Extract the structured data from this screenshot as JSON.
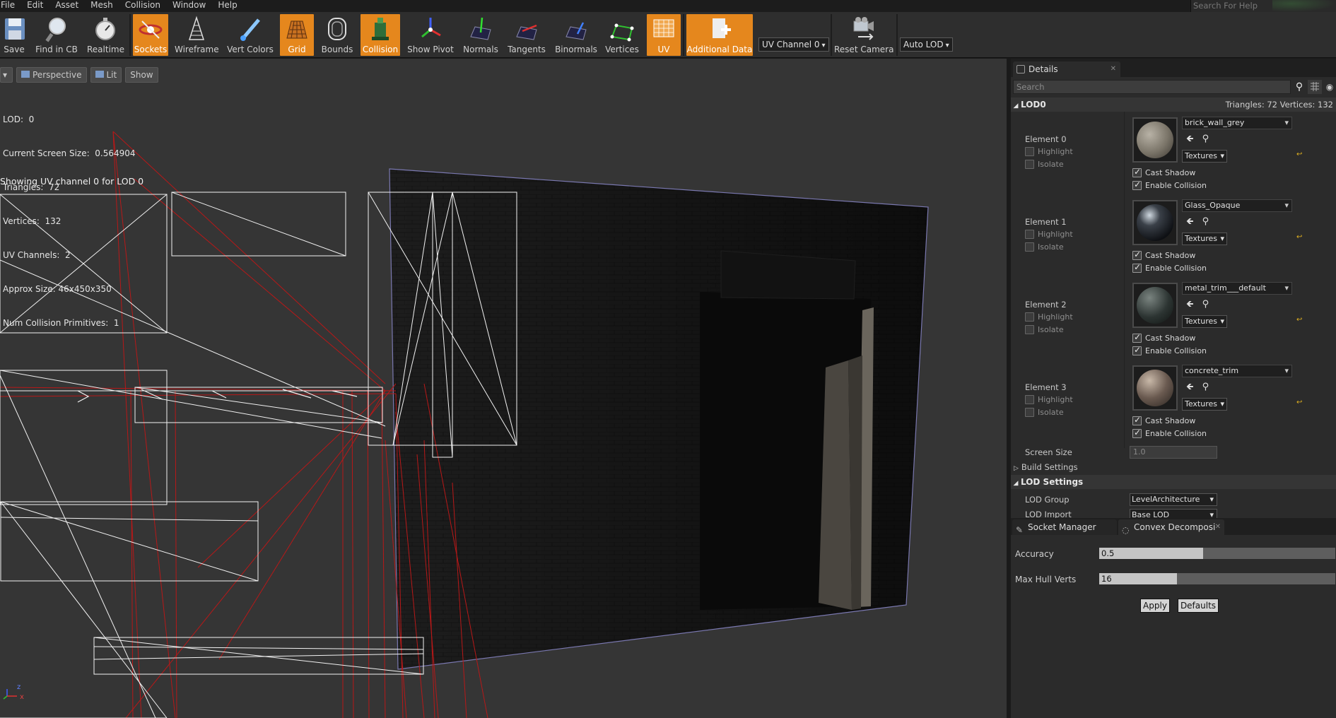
{
  "menu": [
    "File",
    "Edit",
    "Asset",
    "Mesh",
    "Collision",
    "Window",
    "Help"
  ],
  "help_search_placeholder": "Search For Help",
  "toolbar": {
    "buttons": [
      {
        "label": "Save",
        "icon": "floppy-disk-icon",
        "active": false
      },
      {
        "label": "Find in CB",
        "icon": "magnifier-icon",
        "active": false
      },
      {
        "label": "Realtime",
        "icon": "stopwatch-icon",
        "active": false
      },
      {
        "label": "Sockets",
        "icon": "socket-icon",
        "active": true
      },
      {
        "label": "Wireframe",
        "icon": "wireframe-icon",
        "active": false
      },
      {
        "label": "Vert Colors",
        "icon": "paintbrush-icon",
        "active": false
      },
      {
        "label": "Grid",
        "icon": "grid-icon",
        "active": true
      },
      {
        "label": "Bounds",
        "icon": "bounds-icon",
        "active": false
      },
      {
        "label": "Collision",
        "icon": "collision-icon",
        "active": true
      },
      {
        "label": "Show Pivot",
        "icon": "pivot-icon",
        "active": false
      },
      {
        "label": "Normals",
        "icon": "normals-icon",
        "active": false
      },
      {
        "label": "Tangents",
        "icon": "tangents-icon",
        "active": false
      },
      {
        "label": "Binormals",
        "icon": "binormals-icon",
        "active": false
      },
      {
        "label": "Vertices",
        "icon": "vertices-icon",
        "active": false
      },
      {
        "label": "UV",
        "icon": "uv-icon",
        "active": true
      },
      {
        "label": "Additional Data",
        "icon": "additional-data-icon",
        "active": true
      },
      {
        "label": "Reset Camera",
        "icon": "camera-icon",
        "active": false
      }
    ],
    "uv_channel": "UV Channel 0",
    "auto_lod": "Auto LOD"
  },
  "viewport": {
    "menu_arrow": "▾",
    "perspective": "Perspective",
    "lit": "Lit",
    "show": "Show",
    "stats": [
      "LOD:  0",
      "Current Screen Size:  0.564904",
      "Triangles:  72",
      "Vertices:  132",
      "UV Channels:  2",
      "Approx Size: 46x450x350",
      "Num Collision Primitives:  1"
    ],
    "uv_message": "Showing UV channel 0 for LOD 0",
    "axis_z": "z",
    "axis_x": "x"
  },
  "details": {
    "tab_label": "Details",
    "search_placeholder": "Search",
    "lod0": {
      "title": "LOD0",
      "stats": "Triangles: 72   Vertices: 132",
      "elements": [
        {
          "label": "Element 0",
          "material": "brick_wall_grey",
          "textures": "Textures",
          "highlight": "Highlight",
          "isolate": "Isolate",
          "cast_shadow": "Cast Shadow",
          "enable_collision": "Enable Collision"
        },
        {
          "label": "Element 1",
          "material": "Glass_Opaque",
          "textures": "Textures",
          "highlight": "Highlight",
          "isolate": "Isolate",
          "cast_shadow": "Cast Shadow",
          "enable_collision": "Enable Collision"
        },
        {
          "label": "Element 2",
          "material": "metal_trim___default",
          "textures": "Textures",
          "highlight": "Highlight",
          "isolate": "Isolate",
          "cast_shadow": "Cast Shadow",
          "enable_collision": "Enable Collision"
        },
        {
          "label": "Element 3",
          "material": "concrete_trim",
          "textures": "Textures",
          "highlight": "Highlight",
          "isolate": "Isolate",
          "cast_shadow": "Cast Shadow",
          "enable_collision": "Enable Collision"
        }
      ],
      "screen_size_label": "Screen Size",
      "screen_size_value": "1.0",
      "build_settings": "Build Settings"
    },
    "lod_settings": {
      "title": "LOD Settings",
      "lod_group_label": "LOD Group",
      "lod_group_value": "LevelArchitecture",
      "lod_import_label": "LOD Import",
      "lod_import_value": "Base LOD"
    }
  },
  "bottom": {
    "tab_socket": "Socket Manager",
    "tab_convex": "Convex Decomposi",
    "accuracy_label": "Accuracy",
    "accuracy_value": "0.5",
    "accuracy_fraction": 0.44,
    "max_hull_label": "Max Hull Verts",
    "max_hull_value": "16",
    "max_hull_fraction": 0.33,
    "apply": "Apply",
    "defaults": "Defaults"
  },
  "colors": {
    "accent": "#e5871d",
    "collision_lines": "#c01818",
    "uv_lines": "#ffffff"
  }
}
